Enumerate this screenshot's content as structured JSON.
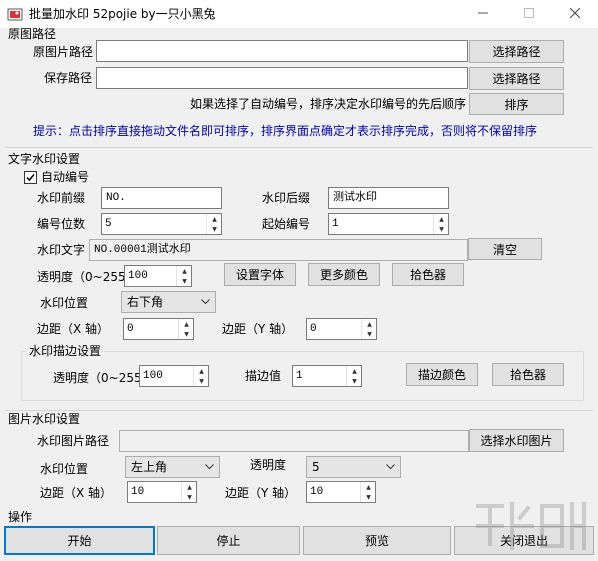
{
  "window": {
    "title": "批量加水印 52pojie by一只小黑兔",
    "minimize_icon": "minimize-icon",
    "maximize_icon": "maximize-icon",
    "close_icon": "close-icon"
  },
  "source_group": {
    "title": "原图路径",
    "source_label": "原图片路径",
    "source_value": "",
    "source_button": "选择路径",
    "save_label": "保存路径",
    "save_value": "",
    "save_button": "选择路径",
    "sort_note": "如果选择了自动编号，排序决定水印编号的先后顺序",
    "sort_button": "排序",
    "tip": "提示：点击排序直接拖动文件名即可排序，排序界面点确定才表示排序完成，否则将不保留排序"
  },
  "text_group": {
    "title": "文字水印设置",
    "auto_number_label": "自动编号",
    "auto_number_checked": true,
    "prefix_label": "水印前缀",
    "prefix_value": "NO.",
    "suffix_label": "水印后缀",
    "suffix_value": "测试水印",
    "digits_label": "编号位数",
    "digits_value": "5",
    "start_label": "起始编号",
    "start_value": "1",
    "text_label": "水印文字",
    "text_value": "NO.00001测试水印",
    "clear_button": "清空",
    "opacity_label": "透明度（0~255）",
    "opacity_value": "100",
    "font_button": "设置字体",
    "more_colors_button": "更多颜色",
    "picker_button": "拾色器",
    "position_label": "水印位置",
    "position_value": "右下角",
    "margin_x_label": "边距（X 轴）",
    "margin_x_value": "0",
    "margin_y_label": "边距（Y 轴）",
    "margin_y_value": "0"
  },
  "stroke_group": {
    "title": "水印描边设置",
    "opacity_label": "透明度（0~255）",
    "opacity_value": "100",
    "width_label": "描边值",
    "width_value": "1",
    "color_button": "描边颜色",
    "picker_button": "拾色器"
  },
  "image_group": {
    "title": "图片水印设置",
    "path_label": "水印图片路径",
    "path_value": "",
    "path_button": "选择水印图片",
    "position_label": "水印位置",
    "position_value": "左上角",
    "opacity_label": "透明度",
    "opacity_value": "5",
    "margin_x_label": "边距（X 轴）",
    "margin_x_value": "10",
    "margin_y_label": "边距（Y 轴）",
    "margin_y_value": "10"
  },
  "actions": {
    "title": "操作",
    "start": "开始",
    "stop": "停止",
    "preview": "预览",
    "exit": "关闭退出"
  },
  "colors": {
    "hint_text": "#0000b4",
    "focus_border": "#0078d7",
    "client_bg": "#f0f0f0",
    "button_bg": "#e1e1e1"
  }
}
